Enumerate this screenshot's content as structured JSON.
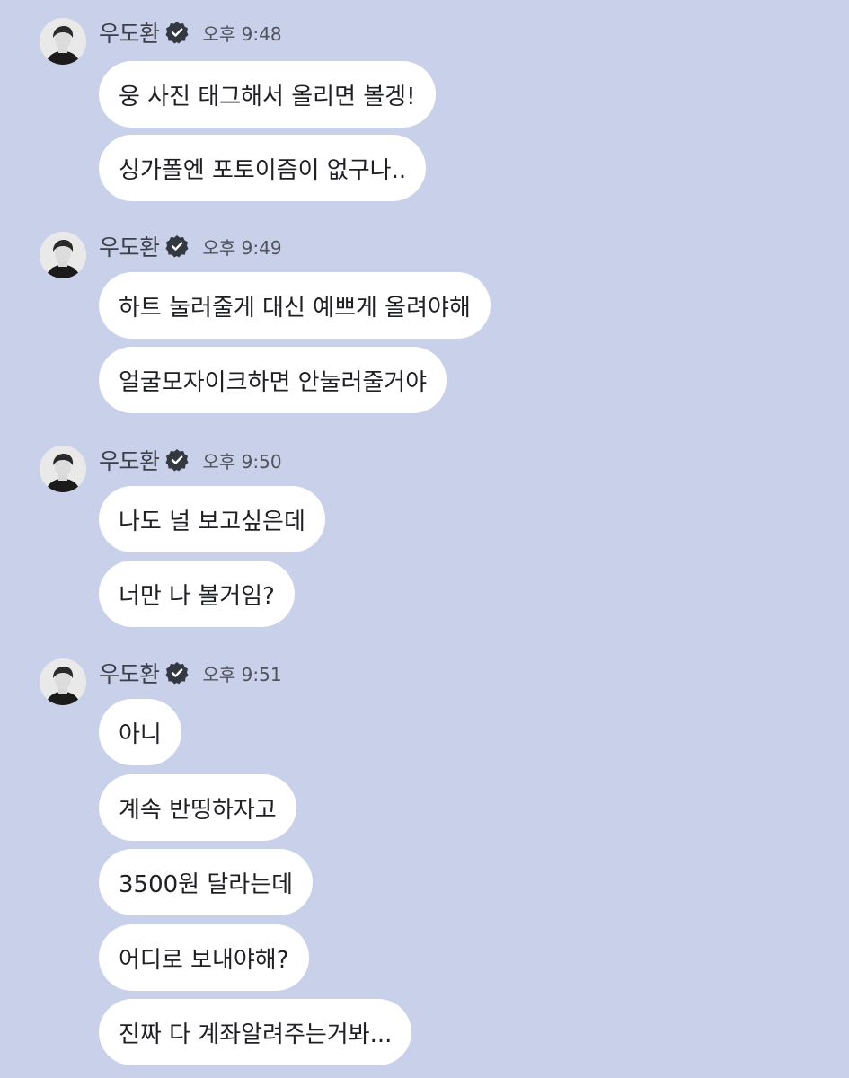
{
  "messages": [
    {
      "sender": "우도환",
      "time": "오후 9:48",
      "bubbles": [
        "웅 사진 태그해서 올리면 볼겡!",
        "싱가폴엔 포토이즘이 없구나.."
      ]
    },
    {
      "sender": "우도환",
      "time": "오후 9:49",
      "bubbles": [
        "하트 눌러줄게 대신 예쁘게 올려야해",
        "얼굴모자이크하면 안눌러줄거야"
      ]
    },
    {
      "sender": "우도환",
      "time": "오후 9:50",
      "bubbles": [
        "나도 널 보고싶은데",
        "너만 나 볼거임?"
      ]
    },
    {
      "sender": "우도환",
      "time": "오후 9:51",
      "bubbles": [
        "아니",
        "계속 반띵하자고",
        "3500원 달라는데",
        "어디로 보내야해?",
        "진짜 다 계좌알려주는거봐..."
      ]
    }
  ],
  "icons": {
    "avatar": "avatar",
    "verified": "verified-badge-icon"
  },
  "colors": {
    "background": "#c9d0ea",
    "bubble": "#ffffff",
    "text": "#1f2024",
    "badge": "#333841"
  }
}
